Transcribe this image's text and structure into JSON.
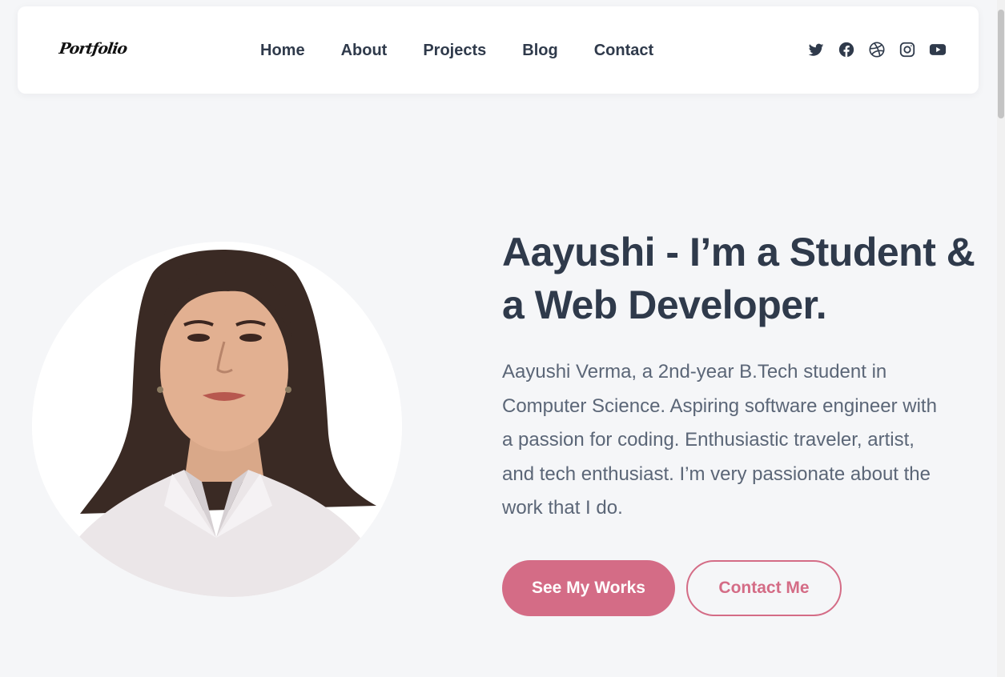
{
  "header": {
    "logo_text": "Portfolio",
    "nav": [
      "Home",
      "About",
      "Projects",
      "Blog",
      "Contact"
    ],
    "socials": [
      "twitter-icon",
      "facebook-icon",
      "dribbble-icon",
      "instagram-icon",
      "youtube-icon"
    ]
  },
  "hero": {
    "title": "Aayushi - I’m a Student & a Web Developer.",
    "description": "Aayushi Verma, a 2nd-year B.Tech student in Computer Science. Aspiring software engineer with a passion for coding. Enthusiastic traveler, artist, and tech enthusiast. I’m very passionate about the work that I do.",
    "primary_button": "See My Works",
    "secondary_button": "Contact Me"
  },
  "colors": {
    "accent": "#d46c86",
    "text": "#2f3a4b",
    "muted": "#5b6677",
    "background": "#f5f6f8"
  }
}
